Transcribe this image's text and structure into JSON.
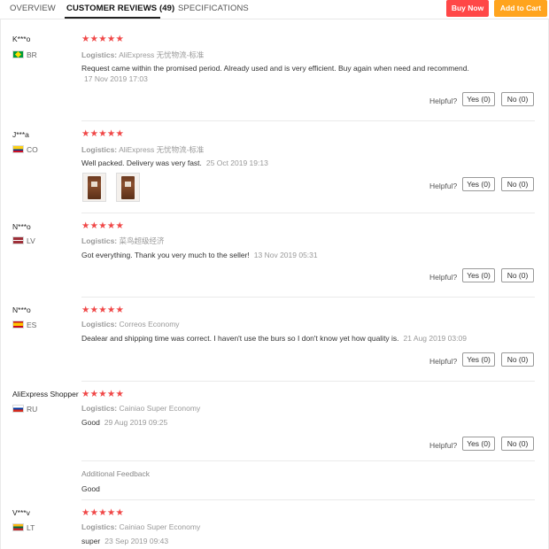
{
  "tabs": {
    "overview": "OVERVIEW",
    "reviews": "CUSTOMER REVIEWS (49)",
    "specifications": "SPECIFICATIONS"
  },
  "actions": {
    "buy_now": "Buy Now",
    "add_to_cart": "Add to Cart"
  },
  "common": {
    "helpful": "Helpful?",
    "logistics_label": "Logistics:",
    "stars": "★★★★★",
    "yes": "Yes (0)",
    "no": "No (0)"
  },
  "reviews": [
    {
      "user": "K***o",
      "country": "BR",
      "flag_colors": [
        "#009b3a",
        "#ffdf00"
      ],
      "rating": 5,
      "logistics": "AliExpress 无忧物流-标准",
      "text": "Request came within the promised period. Already used and is very efficient. Buy again when need and recommend.",
      "date": "17 Nov 2019 17:03"
    },
    {
      "user": "J***a",
      "country": "CO",
      "flag_colors": [
        "#fcd116",
        "#003893",
        "#ce1126"
      ],
      "rating": 5,
      "logistics": "AliExpress 无忧物流-标准",
      "text": "Well packed. Delivery was very fast.",
      "date": "25 Oct 2019 19:13",
      "photos": 2
    },
    {
      "user": "N***o",
      "country": "LV",
      "flag_colors": [
        "#9e3039",
        "#ffffff"
      ],
      "rating": 5,
      "logistics": "菜鸟超级经济",
      "text": "Got everything. Thank you very much to the seller!",
      "date": "13 Nov 2019 05:31"
    },
    {
      "user": "N***o",
      "country": "ES",
      "flag_colors": [
        "#c60b1e",
        "#ffc400"
      ],
      "rating": 5,
      "logistics": "Correos Economy",
      "text": "Dealear and shipping time was correct. I haven't use the burs so I don't know yet how quality is.",
      "date": "21 Aug 2019 03:09"
    },
    {
      "user": "AliExpress Shopper",
      "country": "RU",
      "flag_colors": [
        "#ffffff",
        "#0039a6",
        "#d52b1e"
      ],
      "rating": 5,
      "logistics": "Cainiao Super Economy",
      "text": "Good",
      "date": "29 Aug 2019 09:25",
      "additional_feedback_title": "Additional Feedback",
      "additional_feedback": "Good"
    },
    {
      "user": "V***v",
      "country": "LT",
      "flag_colors": [
        "#fdb913",
        "#006a44",
        "#c1272d"
      ],
      "rating": 5,
      "logistics": "Cainiao Super Economy",
      "text": "super",
      "date": "23 Sep 2019 09:43"
    }
  ]
}
